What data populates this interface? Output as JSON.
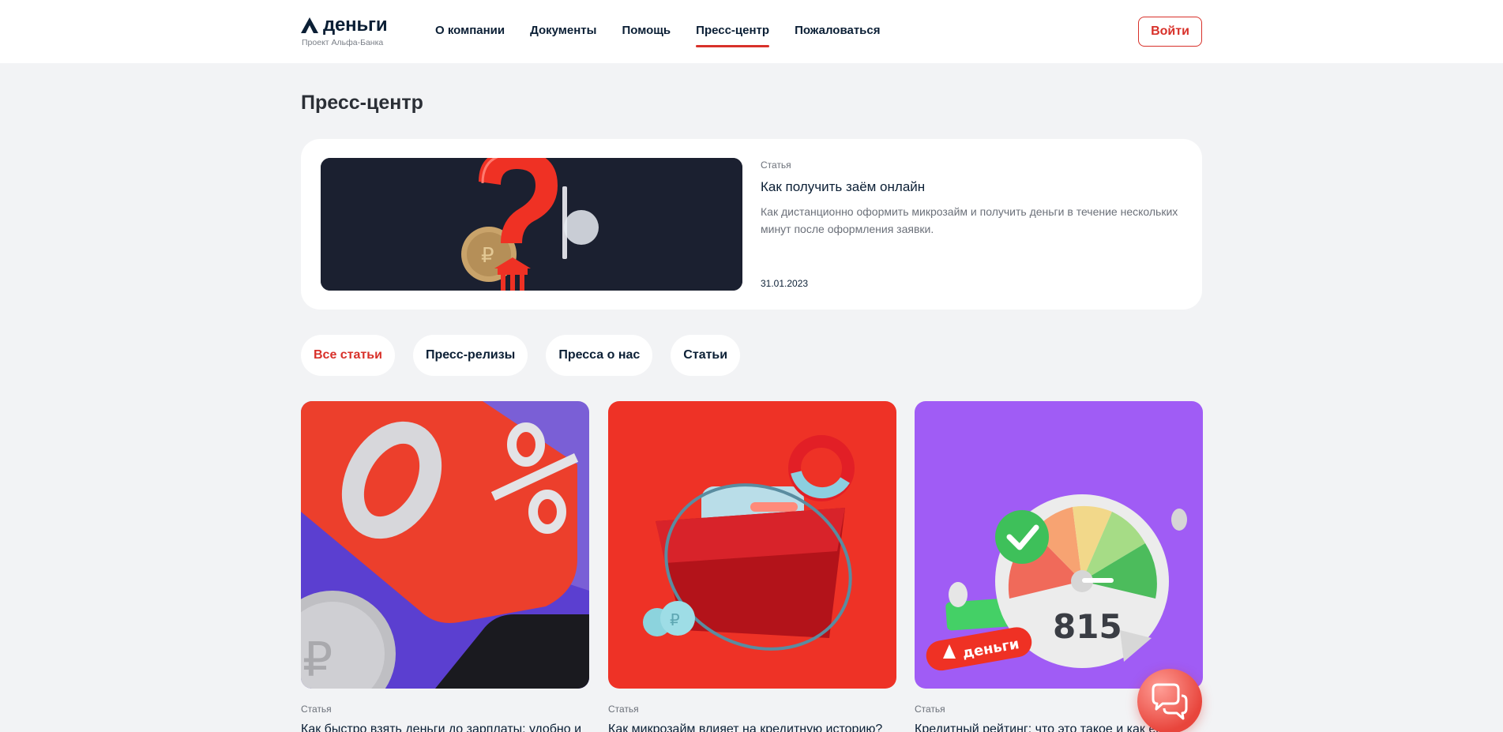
{
  "header": {
    "logo_word": "деньги",
    "logo_sub": "Проект Альфа-Банка",
    "nav": [
      {
        "label": "О компании",
        "active": false
      },
      {
        "label": "Документы",
        "active": false
      },
      {
        "label": "Помощь",
        "active": false
      },
      {
        "label": "Пресс-центр",
        "active": true
      },
      {
        "label": "Пожаловаться",
        "active": false
      }
    ],
    "login_label": "Войти"
  },
  "page": {
    "title": "Пресс-центр"
  },
  "featured": {
    "tag": "Статья",
    "title": "Как получить заём онлайн",
    "description": "Как дистанционно оформить микрозайм и получить деньги в течение нескольких минут после оформления заявки.",
    "date": "31.01.2023"
  },
  "filters": [
    {
      "label": "Все статьи",
      "active": true
    },
    {
      "label": "Пресс-релизы",
      "active": false
    },
    {
      "label": "Пресса о нас",
      "active": false
    },
    {
      "label": "Статьи",
      "active": false
    }
  ],
  "articles": [
    {
      "tag": "Статья",
      "title": "Как быстро взять деньги до зарплаты: удобно и"
    },
    {
      "tag": "Статья",
      "title": "Как микрозайм влияет на кредитную историю?"
    },
    {
      "tag": "Статья",
      "title": "Кредитный рейтинг: что это такое и как его"
    }
  ],
  "images": {
    "card3_badge": "деньги",
    "card3_score": "815"
  },
  "colors": {
    "accent": "#d8312a",
    "background": "#f2f3f5",
    "text": "#0b1f35",
    "muted": "#6b7079"
  }
}
